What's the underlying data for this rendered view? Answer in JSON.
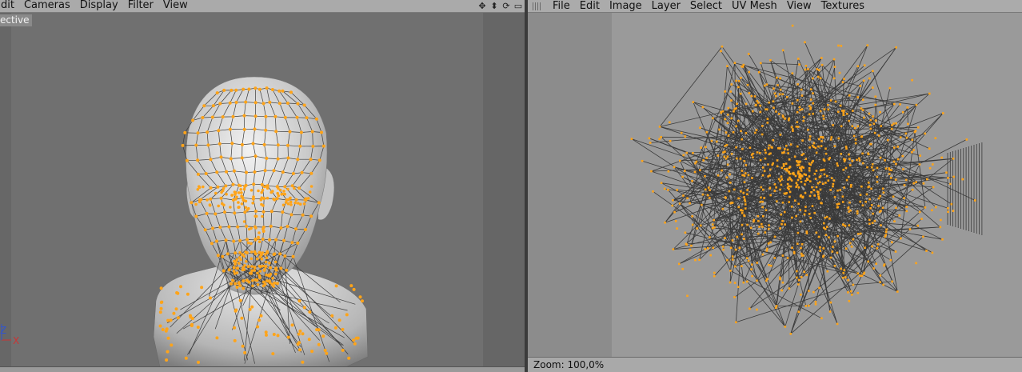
{
  "left_panel": {
    "menu": [
      "dit",
      "Cameras",
      "Display",
      "Filter",
      "View"
    ],
    "viewport_label": "ective",
    "nav_icons": [
      "move-icon",
      "zoom-icon",
      "rotate-icon",
      "maximize-icon"
    ],
    "axis_labels": {
      "x": "X",
      "z": "Z"
    }
  },
  "right_panel": {
    "menu": [
      "File",
      "Edit",
      "Image",
      "Layer",
      "Select",
      "UV Mesh",
      "View",
      "Textures"
    ],
    "status": "Zoom: 100,0%"
  },
  "colors": {
    "point": "#ffa419",
    "wire": "#3c3c3c",
    "viewport_bg": "#707070",
    "uv_bg": "#9a9a9a"
  }
}
